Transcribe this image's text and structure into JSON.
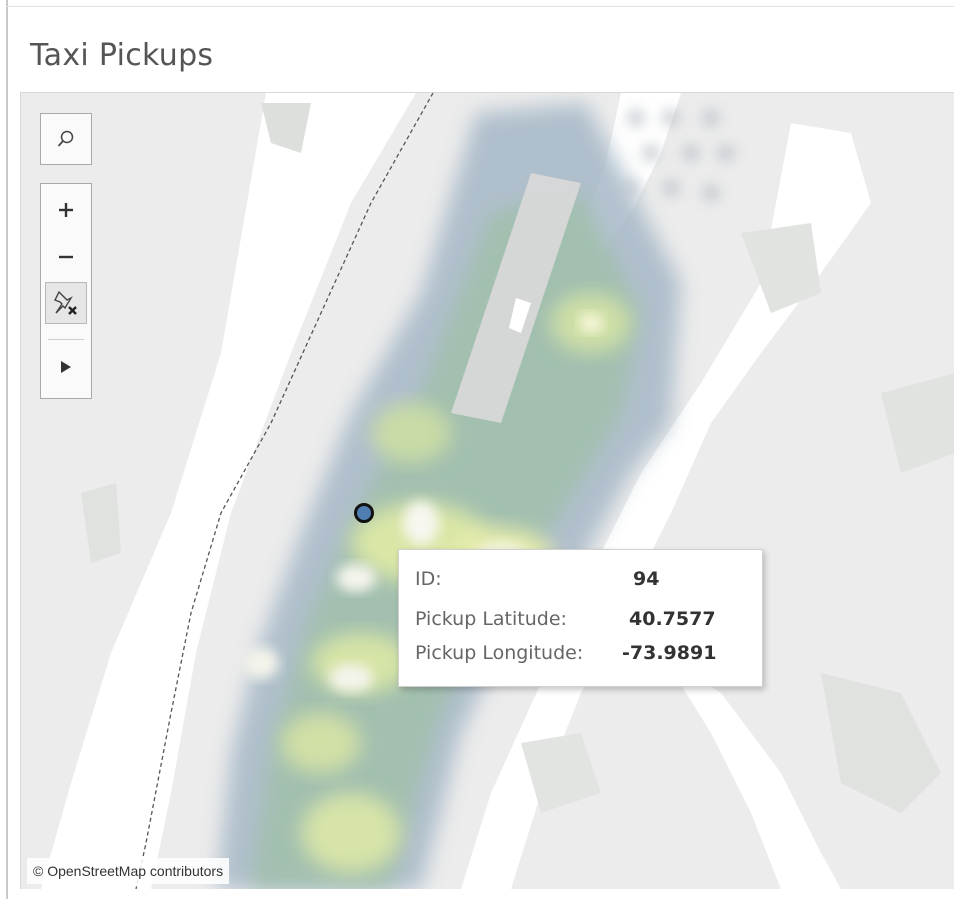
{
  "header": {
    "title": "Taxi Pickups"
  },
  "map_controls": {
    "search_icon": "search-icon",
    "zoom_in_icon": "plus-icon",
    "zoom_out_icon": "minus-icon",
    "reset_icon": "pin-reset-icon",
    "play_icon": "play-icon"
  },
  "tooltip": {
    "rows": [
      {
        "label": "ID:",
        "value": "94"
      },
      {
        "label": "Pickup Latitude:",
        "value": "40.7577"
      },
      {
        "label": "Pickup Longitude:",
        "value": "-73.9891"
      }
    ]
  },
  "attribution": "© OpenStreetMap contributors",
  "colors": {
    "land": "#ececec",
    "water": "#ffffff",
    "park": "#dfe3df",
    "heat_low": "#9fb3c8",
    "heat_mid": "#bcd6a4",
    "heat_high": "#f3f1b0",
    "marker": "#4f7fb0"
  }
}
